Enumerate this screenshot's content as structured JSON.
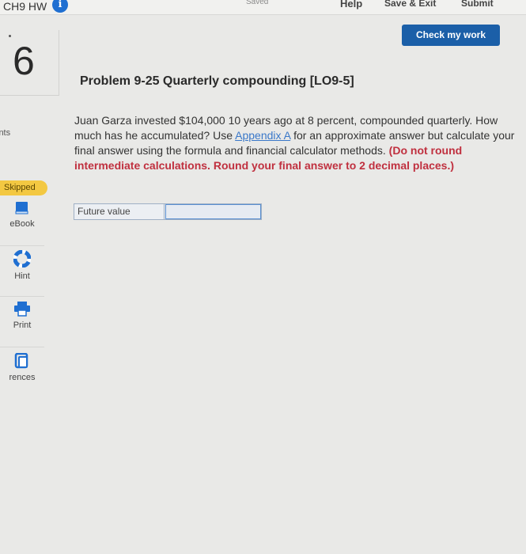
{
  "header": {
    "title": "CH9 HW",
    "info_icon": "i",
    "saved_label": "Saved",
    "help_label": "Help",
    "save_exit_label": "Save & Exit",
    "submit_label": "Submit",
    "check_button": "Check my work"
  },
  "sidebar": {
    "question_number": "6",
    "points_label": "ints",
    "status_badge": "Skipped",
    "tools": [
      {
        "label": "eBook",
        "icon": "book-icon"
      },
      {
        "label": "Hint",
        "icon": "lifebuoy-icon"
      },
      {
        "label": "Print",
        "icon": "printer-icon"
      },
      {
        "label": "rences",
        "icon": "references-icon"
      }
    ]
  },
  "problem": {
    "title": "Problem 9-25 Quarterly compounding [LO9-5]",
    "text_part1": "Juan Garza invested $104,000 10 years ago at 8 percent, compounded quarterly. How much has he accumulated? Use ",
    "link_text": "Appendix A",
    "text_part2": " for an approximate answer but calculate your final answer using the formula and financial calculator methods. ",
    "instruction": "(Do not round intermediate calculations. Round your final answer to 2 decimal places.)"
  },
  "answer": {
    "label": "Future value",
    "value": ""
  },
  "colors": {
    "accent": "#1b5fa8",
    "badge": "#f3c842",
    "emphasis": "#c0303f"
  }
}
